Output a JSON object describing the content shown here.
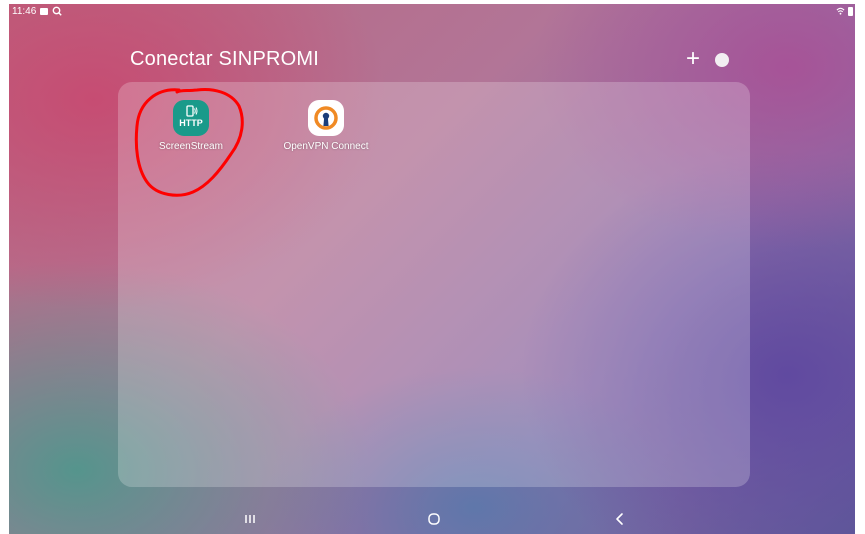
{
  "status_bar": {
    "time": "11:46"
  },
  "folder": {
    "title": "Conectar SINPROMI",
    "add_label": "+"
  },
  "apps": [
    {
      "label": "ScreenStream",
      "icon": "screenstream-http-icon",
      "icon_text": "HTTP",
      "icon_color": "#1a9a8a"
    },
    {
      "label": "OpenVPN Connect",
      "icon": "openvpn-icon",
      "icon_color": "#ffffff"
    }
  ],
  "annotation": {
    "color": "#ff0000",
    "shape": "hand-drawn circle around ScreenStream"
  },
  "nav": {
    "recents_icon": "recents-icon",
    "home_icon": "home-icon",
    "back_icon": "back-icon"
  }
}
